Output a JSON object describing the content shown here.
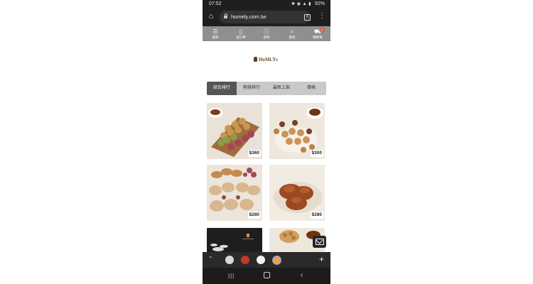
{
  "status_bar": {
    "time": "07:52",
    "icons": "✱ ◉ ▲ ▮",
    "battery": "92%"
  },
  "browser": {
    "url": "homely.com.tw",
    "tab_count": "8",
    "menu_label": "⋮"
  },
  "site_nav": [
    {
      "label": "選單",
      "icon": "menu-icon"
    },
    {
      "label": "查訂單",
      "icon": "document-icon"
    },
    {
      "label": "說明",
      "icon": "info-icon"
    },
    {
      "label": "搜尋",
      "icon": "search-icon"
    },
    {
      "label": "購物車",
      "icon": "cart-icon"
    }
  ],
  "cart_badge": "0",
  "logo_text": "HoMi.Ys",
  "sort_tabs": [
    {
      "label": "綜合排行",
      "active": true
    },
    {
      "label": "熱銷排行",
      "active": false
    },
    {
      "label": "最新上架",
      "active": false
    },
    {
      "label": "價格",
      "active": false
    }
  ],
  "products": [
    {
      "price": "$360"
    },
    {
      "price": "$300"
    },
    {
      "price": "$280"
    },
    {
      "price": "$280"
    }
  ],
  "colors": {
    "nav_bg": "#8f8f8f",
    "sort_active": "#555555",
    "cookie_brown": "#b07a45"
  }
}
